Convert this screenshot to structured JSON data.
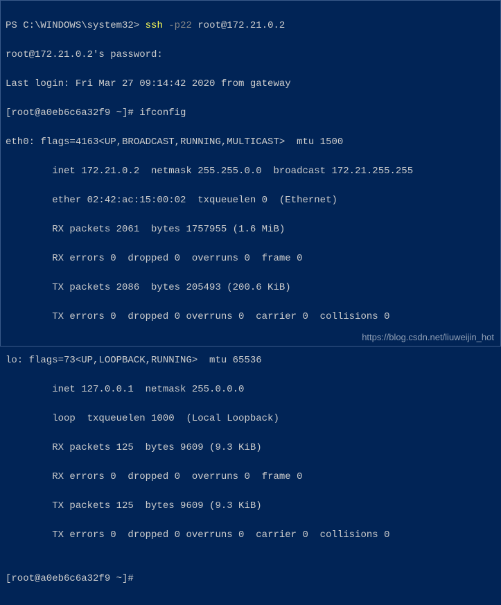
{
  "prompt1": {
    "ps": "PS C:\\WINDOWS\\system32> ",
    "cmd": "ssh",
    "arg": " -p22",
    "rest": " root@172.21.0.2"
  },
  "lines": {
    "l2": "root@172.21.0.2's password:",
    "l3": "Last login: Fri Mar 27 09:14:42 2020 from gateway",
    "l4": "[root@a0eb6c6a32f9 ~]# ifconfig",
    "l5": "eth0: flags=4163<UP,BROADCAST,RUNNING,MULTICAST>  mtu 1500",
    "l6": "        inet 172.21.0.2  netmask 255.255.0.0  broadcast 172.21.255.255",
    "l7": "        ether 02:42:ac:15:00:02  txqueuelen 0  (Ethernet)",
    "l8": "        RX packets 2061  bytes 1757955 (1.6 MiB)",
    "l9": "        RX errors 0  dropped 0  overruns 0  frame 0",
    "l10": "        TX packets 2086  bytes 205493 (200.6 KiB)",
    "l11": "        TX errors 0  dropped 0 overruns 0  carrier 0  collisions 0",
    "l12": "",
    "l13": "lo: flags=73<UP,LOOPBACK,RUNNING>  mtu 65536",
    "l14": "        inet 127.0.0.1  netmask 255.0.0.0",
    "l15": "        loop  txqueuelen 1000  (Local Loopback)",
    "l16": "        RX packets 125  bytes 9609 (9.3 KiB)",
    "l17": "        RX errors 0  dropped 0  overruns 0  frame 0",
    "l18": "        TX packets 125  bytes 9609 (9.3 KiB)",
    "l19": "        TX errors 0  dropped 0 overruns 0  carrier 0  collisions 0",
    "l20": "",
    "l21": "[root@a0eb6c6a32f9 ~]#"
  },
  "watermark": "https://blog.csdn.net/liuweijin_hot"
}
